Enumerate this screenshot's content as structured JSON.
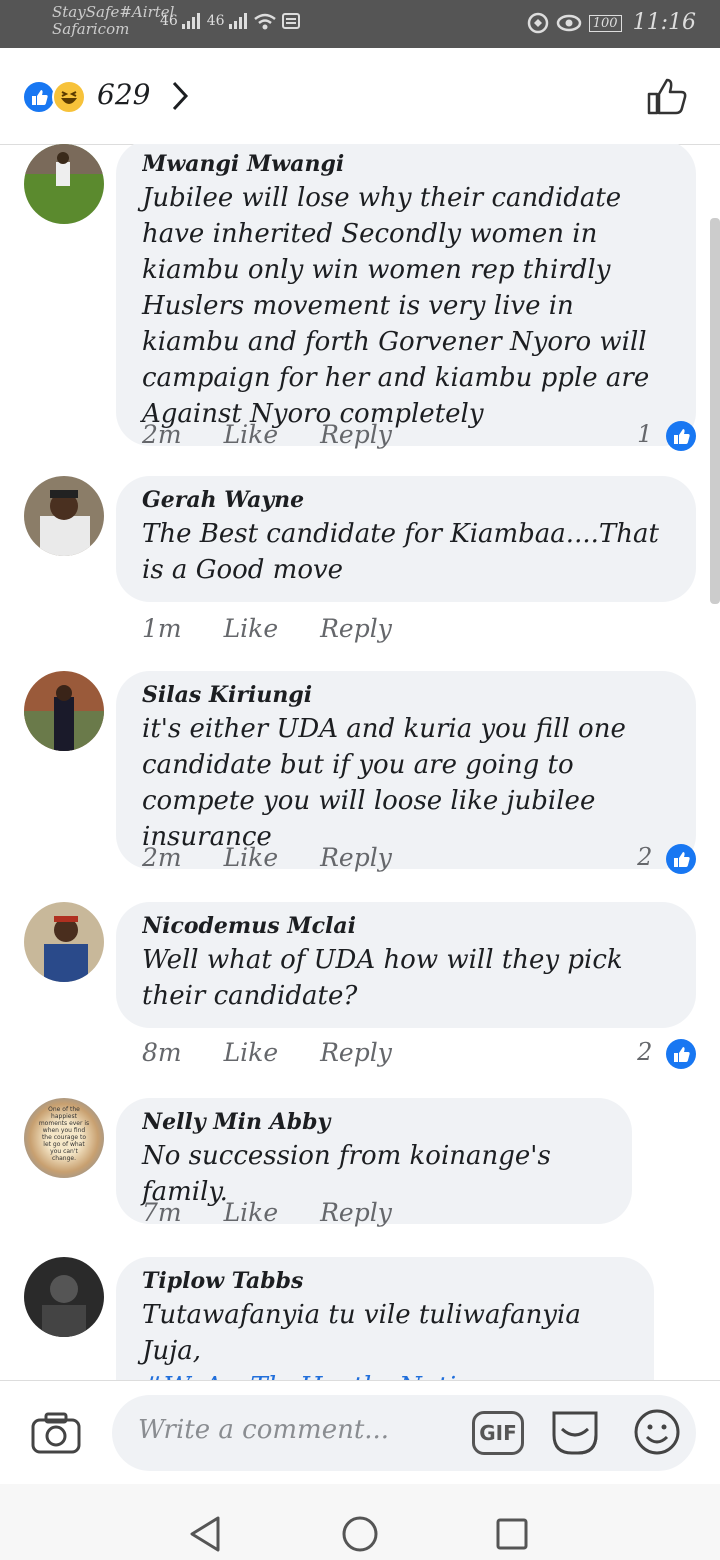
{
  "status_bar": {
    "carrier_line1": "StaySafe#Airtel",
    "carrier_line2": "Safaricom",
    "signal_text": "46",
    "battery": "100",
    "time": "11:16"
  },
  "header": {
    "reaction_count": "629",
    "reactions": [
      "like-icon",
      "haha-icon"
    ]
  },
  "comments": [
    {
      "name": "Mwangi Mwangi",
      "text": "Jubilee will lose why their candidate have inherited Secondly women in kiambu only win women rep thirdly Huslers movement is very live in kiambu and forth Gorvener Nyoro will campaign for her and kiambu pple are Against Nyoro completely",
      "time": "2m",
      "like": "Like",
      "reply": "Reply",
      "likes": "1"
    },
    {
      "name": "Gerah Wayne",
      "text": "The Best candidate for Kiambaa....That is a Good move",
      "time": "1m",
      "like": "Like",
      "reply": "Reply",
      "likes": ""
    },
    {
      "name": "Silas Kiriungi",
      "text": "it's either UDA and kuria you fill one candidate but if you are going to compete you will loose like jubilee insurance",
      "time": "2m",
      "like": "Like",
      "reply": "Reply",
      "likes": "2"
    },
    {
      "name": "Nicodemus Mclai",
      "text": "Well what of UDA how will they pick their candidate?",
      "time": "8m",
      "like": "Like",
      "reply": "Reply",
      "likes": "2"
    },
    {
      "name": "Nelly Min Abby",
      "text": "No succession from koinange's family.",
      "time": "7m",
      "like": "Like",
      "reply": "Reply",
      "likes": "",
      "avatar_text": "One of the happiest moments ever is when you find the courage to let go of what you can't change."
    },
    {
      "name": "Tiplow Tabbs",
      "text": "Tutawafanyia tu vile tuliwafanyia Juja,",
      "hashtag": "#WeAreTheHustlerNation",
      "time": "",
      "like": "",
      "reply": "",
      "likes": ""
    }
  ],
  "composer": {
    "placeholder": "Write a comment...",
    "gif_label": "GIF"
  },
  "colors": {
    "accent": "#1877f2",
    "bubble": "#f0f2f5",
    "meta": "#65676b",
    "hashtag": "#216fdb"
  }
}
